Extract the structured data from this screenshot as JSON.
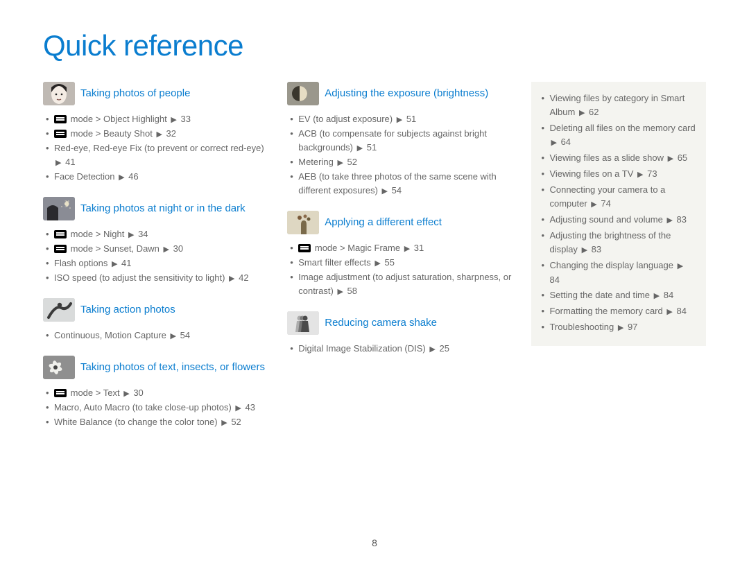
{
  "title": "Quick reference",
  "pageNumber": "8",
  "arrow": "▶",
  "modeLabel": "mode >",
  "col1": {
    "s1": {
      "title": "Taking photos of people",
      "items": [
        {
          "mode": true,
          "text": "Object Highlight",
          "page": "33"
        },
        {
          "mode": true,
          "text": "Beauty Shot",
          "page": "32"
        },
        {
          "text": "Red-eye, Red-eye Fix (to prevent or correct red-eye)",
          "page": "41"
        },
        {
          "text": "Face Detection",
          "page": "46"
        }
      ]
    },
    "s2": {
      "title": "Taking photos at night or in the dark",
      "items": [
        {
          "mode": true,
          "text": "Night",
          "page": "34"
        },
        {
          "mode": true,
          "text": "Sunset, Dawn",
          "page": "30"
        },
        {
          "text": "Flash options",
          "page": "41"
        },
        {
          "text": "ISO speed (to adjust the sensitivity to light)",
          "page": "42"
        }
      ]
    },
    "s3": {
      "title": "Taking action photos",
      "items": [
        {
          "text": "Continuous, Motion Capture",
          "page": "54"
        }
      ]
    },
    "s4": {
      "title": "Taking photos of text, insects, or flowers",
      "items": [
        {
          "mode": true,
          "text": "Text",
          "page": "30"
        },
        {
          "text": "Macro, Auto Macro (to take close-up photos)",
          "page": "43"
        },
        {
          "text": "White Balance (to change the color tone)",
          "page": "52"
        }
      ]
    }
  },
  "col2": {
    "s1": {
      "title": "Adjusting the exposure (brightness)",
      "items": [
        {
          "text": "EV (to adjust exposure)",
          "page": "51"
        },
        {
          "text": "ACB (to compensate for subjects against bright backgrounds)",
          "page": "51"
        },
        {
          "text": "Metering",
          "page": "52"
        },
        {
          "text": "AEB (to take three photos of the same scene with different exposures)",
          "page": "54"
        }
      ]
    },
    "s2": {
      "title": "Applying a different effect",
      "items": [
        {
          "mode": true,
          "text": "Magic Frame",
          "page": "31"
        },
        {
          "text": "Smart filter effects",
          "page": "55"
        },
        {
          "text": "Image adjustment (to adjust saturation, sharpness, or contrast)",
          "page": "58"
        }
      ]
    },
    "s3": {
      "title": "Reducing camera shake",
      "items": [
        {
          "text": "Digital Image Stabilization (DIS)",
          "page": "25"
        }
      ]
    }
  },
  "sidebar": [
    {
      "text": "Viewing files by category in Smart Album",
      "page": "62"
    },
    {
      "text": "Deleting all files on the memory card",
      "page": "64"
    },
    {
      "text": "Viewing files as a slide show",
      "page": "65"
    },
    {
      "text": "Viewing files on a TV",
      "page": "73"
    },
    {
      "text": "Connecting your camera to a computer",
      "page": "74"
    },
    {
      "text": "Adjusting sound and volume",
      "page": "83"
    },
    {
      "text": "Adjusting the brightness of the display",
      "page": "83"
    },
    {
      "text": "Changing the display language",
      "page": "84"
    },
    {
      "text": "Setting the date and time",
      "page": "84"
    },
    {
      "text": "Formatting the memory card",
      "page": "84"
    },
    {
      "text": "Troubleshooting",
      "page": "97"
    }
  ]
}
